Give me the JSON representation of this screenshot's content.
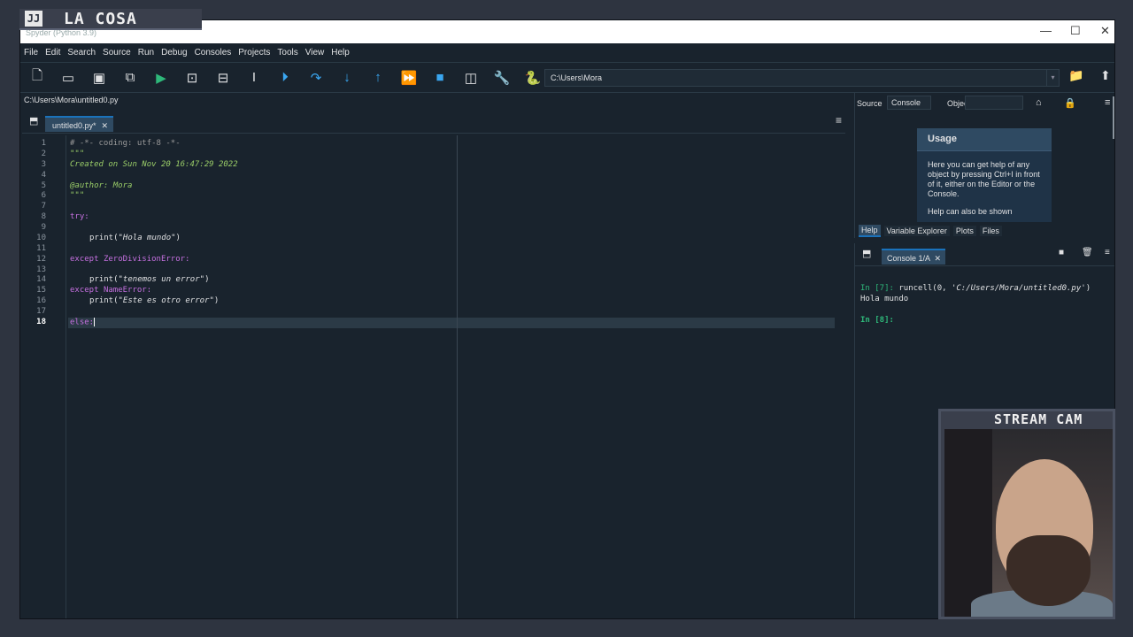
{
  "overlay": {
    "badge": "JJ",
    "title": "LA COSA",
    "cam_label": "STREAM CAM"
  },
  "window": {
    "title": "Spyder (Python 3.9)",
    "min": "—",
    "max": "☐",
    "close": "✕"
  },
  "menu": [
    "File",
    "Edit",
    "Search",
    "Source",
    "Run",
    "Debug",
    "Consoles",
    "Projects",
    "Tools",
    "View",
    "Help"
  ],
  "toolbar": {
    "working_dir": "C:\\Users\\Mora",
    "icons": [
      "new-file-icon",
      "open-file-icon",
      "save-icon",
      "save-all-icon",
      "run-icon",
      "run-cell-icon",
      "run-cell-advance-icon",
      "run-selection-icon",
      "debug-icon",
      "step-icon",
      "step-into-icon",
      "step-return-icon",
      "continue-icon",
      "stop-icon",
      "maximize-pane-icon",
      "preferences-icon",
      "python-path-icon"
    ]
  },
  "editor": {
    "filepath": "C:\\Users\\Mora\\untitled0.py",
    "tab_label": "untitled0.py*",
    "current_line": "18",
    "line_numbers": [
      "1",
      "2",
      "3",
      "4",
      "5",
      "6",
      "7",
      "8",
      "9",
      "10",
      "11",
      "12",
      "13",
      "14",
      "15",
      "16",
      "17",
      "18"
    ],
    "code": {
      "l1": "# -*- coding: utf-8 -*-",
      "l2": "\"\"\"",
      "l3": "Created on Sun Nov 20 16:47:29 2022",
      "l5": "@author: Mora",
      "l6": "\"\"\"",
      "l8_kw": "try:",
      "l10_fn": "print(",
      "l10_str": "\"Hola mundo\"",
      "l10_end": ")",
      "l12_kw": "except",
      "l12_ex": "ZeroDivisionError:",
      "l14_fn": "print(",
      "l14_str": "\"tenemos un error\"",
      "l14_end": ")",
      "l15_kw": "except",
      "l15_ex": "NameError:",
      "l16_fn": "print(",
      "l16_str": "\"Este es otro error\"",
      "l16_end": ")",
      "l18_kw": "else:"
    }
  },
  "help": {
    "source_label": "Source",
    "source_value": "Console",
    "object_label": "Object",
    "usage_title": "Usage",
    "usage_text": "Here you can get help of any object by pressing Ctrl+I in front of it, either on the Editor or the Console.",
    "usage_more": "Help can also be shown",
    "tabs": [
      "Help",
      "Variable Explorer",
      "Plots",
      "Files"
    ]
  },
  "console": {
    "tab_label": "Console 1/A",
    "prompt7": "In [7]:",
    "cmd7_a": " runcell(0, ",
    "cmd7_str": "'C:/Users/Mora/untitled0.py'",
    "cmd7_b": ")",
    "output": "Hola mundo",
    "prompt8": "In [8]:"
  }
}
